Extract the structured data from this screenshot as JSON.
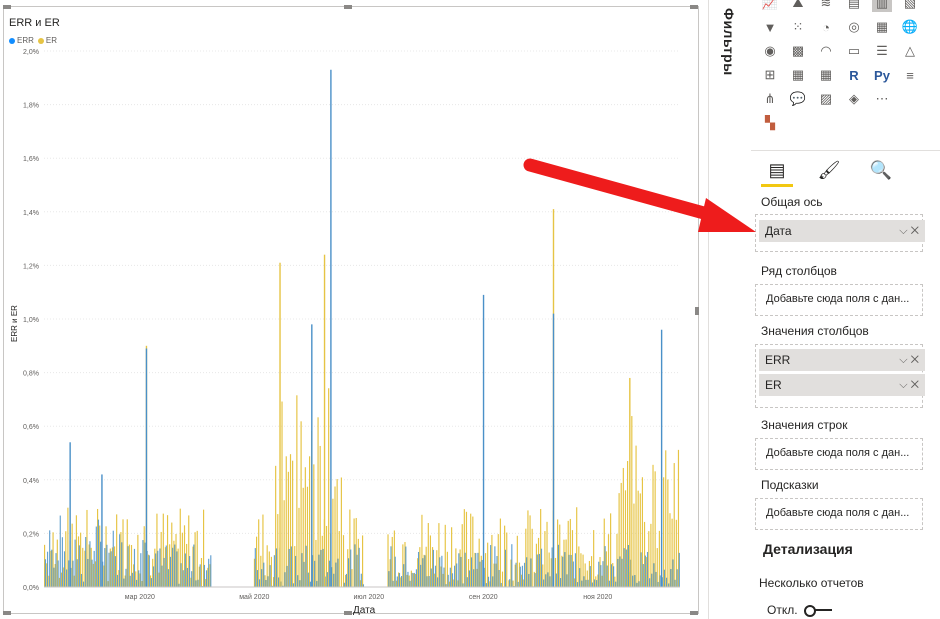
{
  "visual": {
    "title": "ERR и ER",
    "legend": [
      {
        "name": "ERR",
        "color": "#118dff"
      },
      {
        "name": "ER",
        "color": "#e6c444"
      }
    ],
    "y_axis_title": "ERR и ER",
    "x_axis_title": "Дата"
  },
  "chart_data": {
    "type": "bar",
    "title": "ERR и ER",
    "xlabel": "Дата",
    "ylabel": "ERR и ER",
    "ylim": [
      0,
      2.0
    ],
    "y_ticks": [
      "0,0%",
      "0,2%",
      "0,4%",
      "0,6%",
      "0,8%",
      "1,0%",
      "1,2%",
      "1,4%",
      "1,6%",
      "1,8%",
      "2,0%"
    ],
    "x_ticks": [
      "мар 2020",
      "май 2020",
      "июл 2020",
      "сен 2020",
      "ноя 2020"
    ],
    "grid": "horizontal-dotted",
    "legend_position": "top-left",
    "series": [
      {
        "name": "ERR",
        "color": "#4a90c8",
        "peaks": [
          [
            0.54,
            0.04
          ],
          [
            0.89,
            0.16
          ],
          [
            0.42,
            0.09
          ],
          [
            0.98,
            0.42
          ],
          [
            1.93,
            0.45
          ],
          [
            1.09,
            0.69
          ],
          [
            1.02,
            0.8
          ],
          [
            0.96,
            0.97
          ]
        ]
      },
      {
        "name": "ER",
        "color": "#e6c444",
        "peaks": [
          [
            0.9,
            0.16
          ],
          [
            1.21,
            0.37
          ],
          [
            1.24,
            0.44
          ],
          [
            1.41,
            0.8
          ],
          [
            0.78,
            0.92
          ]
        ]
      }
    ]
  },
  "fields_panel": {
    "filters_label": "Фильтры",
    "tabs": [
      "fields",
      "format",
      "analytics"
    ],
    "shared_axis_label": "Общая ось",
    "shared_axis_field": "Дата",
    "column_series_label": "Ряд столбцов",
    "placeholder": "Добавьте сюда поля с дан...",
    "column_values_label": "Значения столбцов",
    "column_values": [
      "ERR",
      "ER"
    ],
    "row_values_label": "Значения строк",
    "tooltips_label": "Подсказки",
    "drill_label": "Детализация",
    "cross_report_label": "Несколько отчетов",
    "toggle_label": "Откл."
  }
}
